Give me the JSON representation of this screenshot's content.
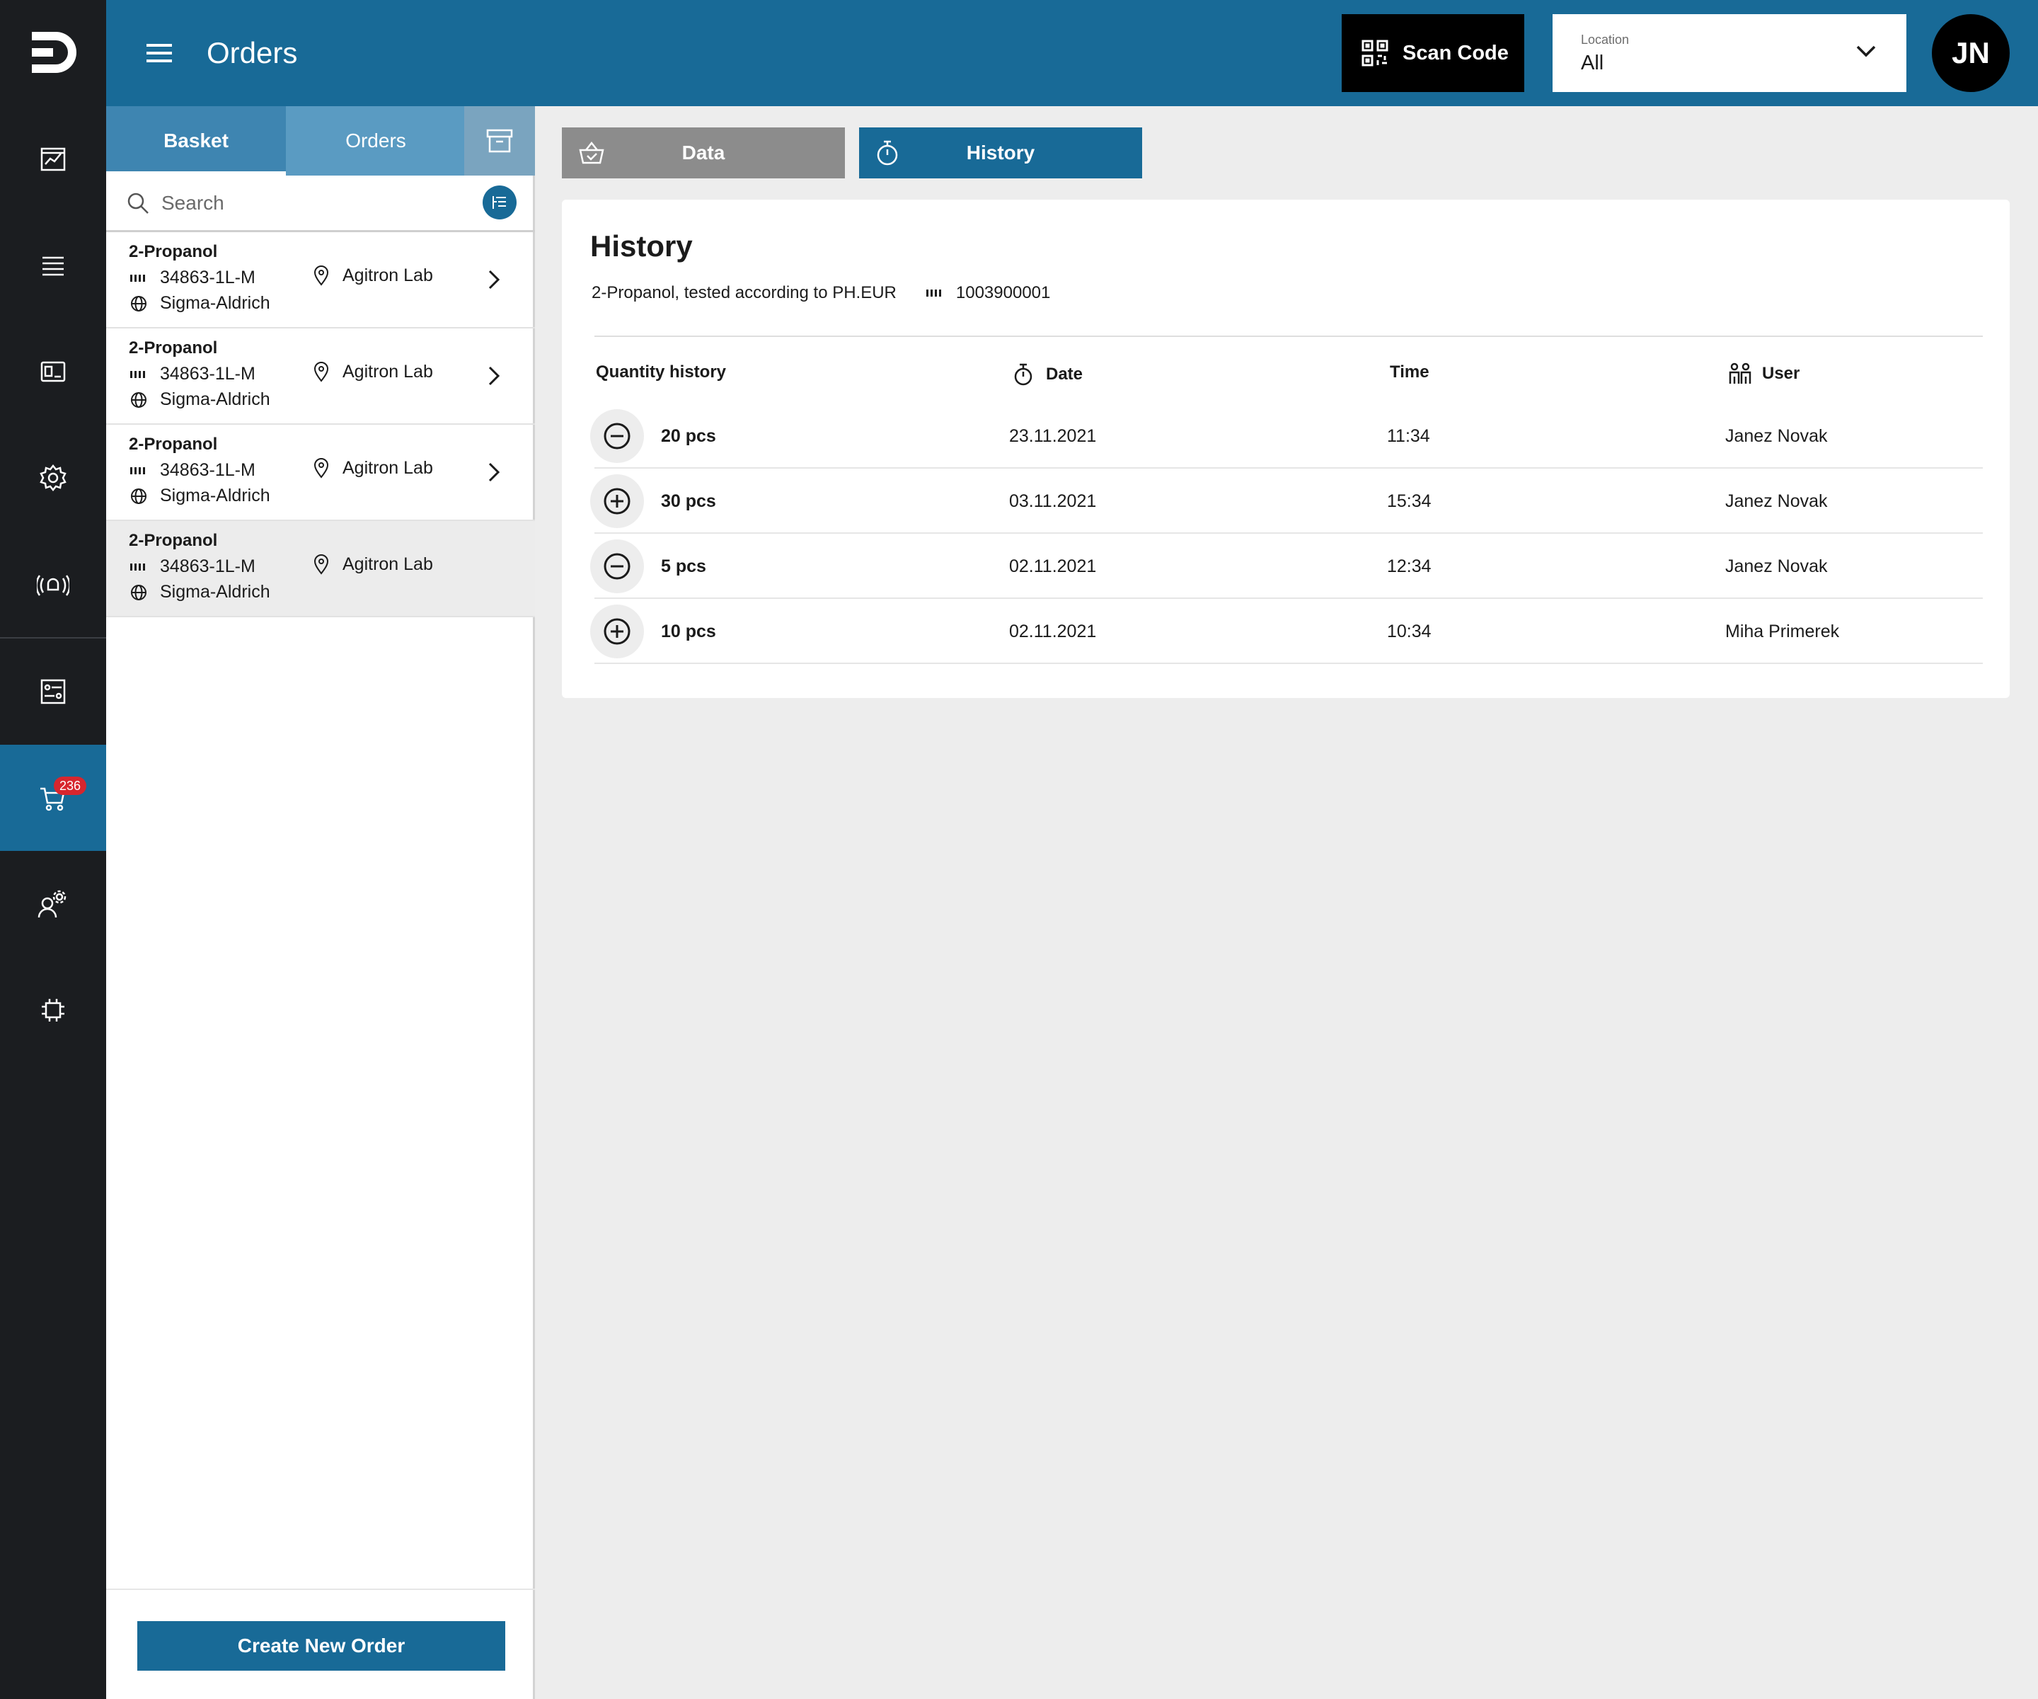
{
  "app": {
    "title": "Orders"
  },
  "nav": {
    "cart_badge": "236",
    "items": [
      "chart-icon",
      "list-icon",
      "inventory-icon",
      "settings-icon",
      "alerts-icon",
      "reports-icon",
      "cart-icon",
      "user-settings-icon",
      "chip-icon"
    ]
  },
  "header": {
    "scan_label": "Scan Code",
    "location_label": "Location",
    "location_value": "All",
    "avatar_initials": "JN"
  },
  "sidebar": {
    "tabs": [
      {
        "label": "Basket",
        "selected": true
      },
      {
        "label": "Orders",
        "selected": false
      }
    ],
    "search_placeholder": "Search",
    "items": [
      {
        "name": "2-Propanol",
        "code": "34863-1L-M",
        "maker": "Sigma-Aldrich",
        "location": "Agitron Lab"
      },
      {
        "name": "2-Propanol",
        "code": "34863-1L-M",
        "maker": "Sigma-Aldrich",
        "location": "Agitron Lab"
      },
      {
        "name": "2-Propanol",
        "code": "34863-1L-M",
        "maker": "Sigma-Aldrich",
        "location": "Agitron Lab"
      },
      {
        "name": "2-Propanol",
        "code": "34863-1L-M",
        "maker": "Sigma-Aldrich",
        "location": "Agitron Lab"
      }
    ],
    "create_label": "Create New Order"
  },
  "panel": {
    "tabs": [
      {
        "label": "Data"
      },
      {
        "label": "History"
      }
    ],
    "title": "History",
    "product": "2-Propanol, tested according to PH.EUR",
    "barcode": "1003900001",
    "columns": {
      "qty": "Quantity history",
      "date": "Date",
      "time": "Time",
      "user": "User"
    },
    "rows": [
      {
        "sign": "minus",
        "qty": "20 pcs",
        "date": "23.11.2021",
        "time": "11:34",
        "user": "Janez Novak"
      },
      {
        "sign": "plus",
        "qty": "30 pcs",
        "date": "03.11.2021",
        "time": "15:34",
        "user": "Janez Novak"
      },
      {
        "sign": "minus",
        "qty": "5 pcs",
        "date": "02.11.2021",
        "time": "12:34",
        "user": "Janez Novak"
      },
      {
        "sign": "plus",
        "qty": "10 pcs",
        "date": "02.11.2021",
        "time": "10:34",
        "user": "Miha Primerek"
      }
    ]
  },
  "colors": {
    "brand": "#186a97",
    "rail": "#1b1d20",
    "badge": "#d7262e"
  }
}
